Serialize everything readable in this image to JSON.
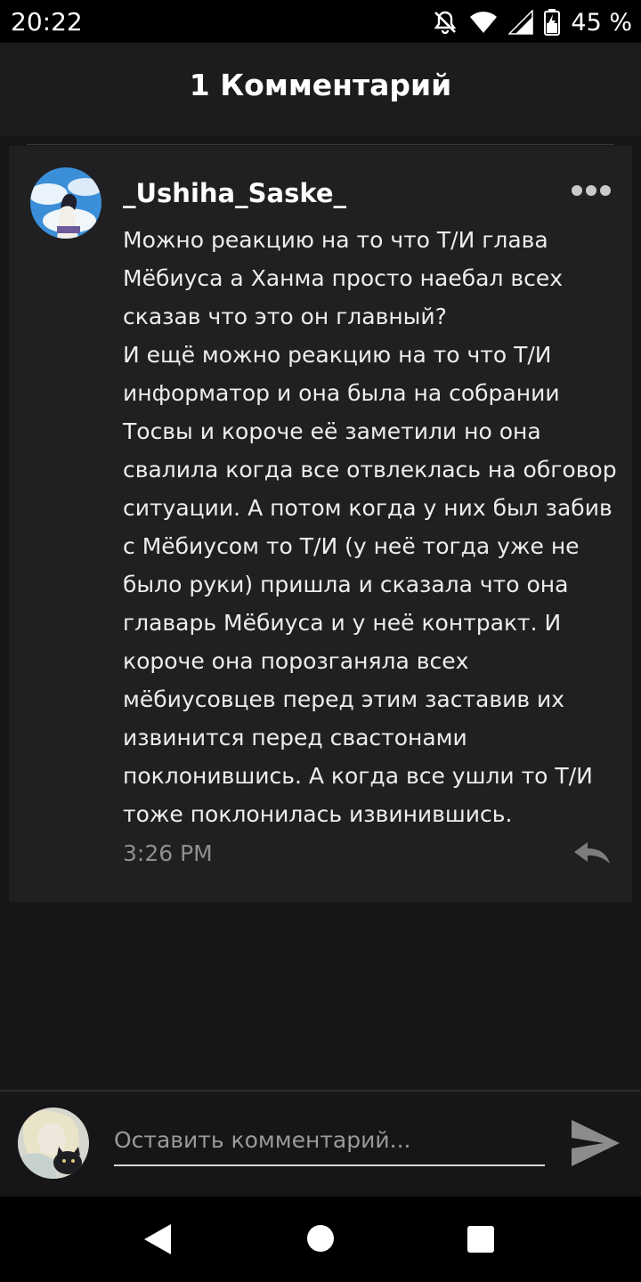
{
  "status_bar": {
    "time": "20:22",
    "battery_percent": "45 %",
    "icons": [
      "notifications-off-icon",
      "wifi-icon",
      "signal-icon",
      "battery-icon"
    ]
  },
  "header": {
    "title": "1 Комментарий"
  },
  "comment": {
    "username": "_Ushiha_Saske_",
    "avatar": "user-avatar",
    "paragraphs": [
      "Можно реакцию на то что Т/И глава Мёбиуса а Ханма просто наебал всех сказав что это он главный?",
      "И ещё можно реакцию на то что Т/И информатор и она была на собрании Тосвы и короче её заметили но она свалила когда все отвлеклась на обговор ситуации. А потом когда у них был забив с Мёбиусом то Т/И (у неё тогда уже не было руки) пришла и сказала что она главарь Мёбиуса и у неё контракт. И короче она порозганяла всех мёбиусовцев перед этим заставив их извинится перед свастонами поклонившись. А когда все ушли то Т/И тоже поклонилась извинившись."
    ],
    "timestamp": "3:26 PM"
  },
  "input": {
    "placeholder": "Оставить комментарий..."
  },
  "colors": {
    "background": "#161517",
    "card": "#201f21",
    "header": "#1c1b1d",
    "text": "#ededed",
    "muted": "#8f8f8f"
  }
}
